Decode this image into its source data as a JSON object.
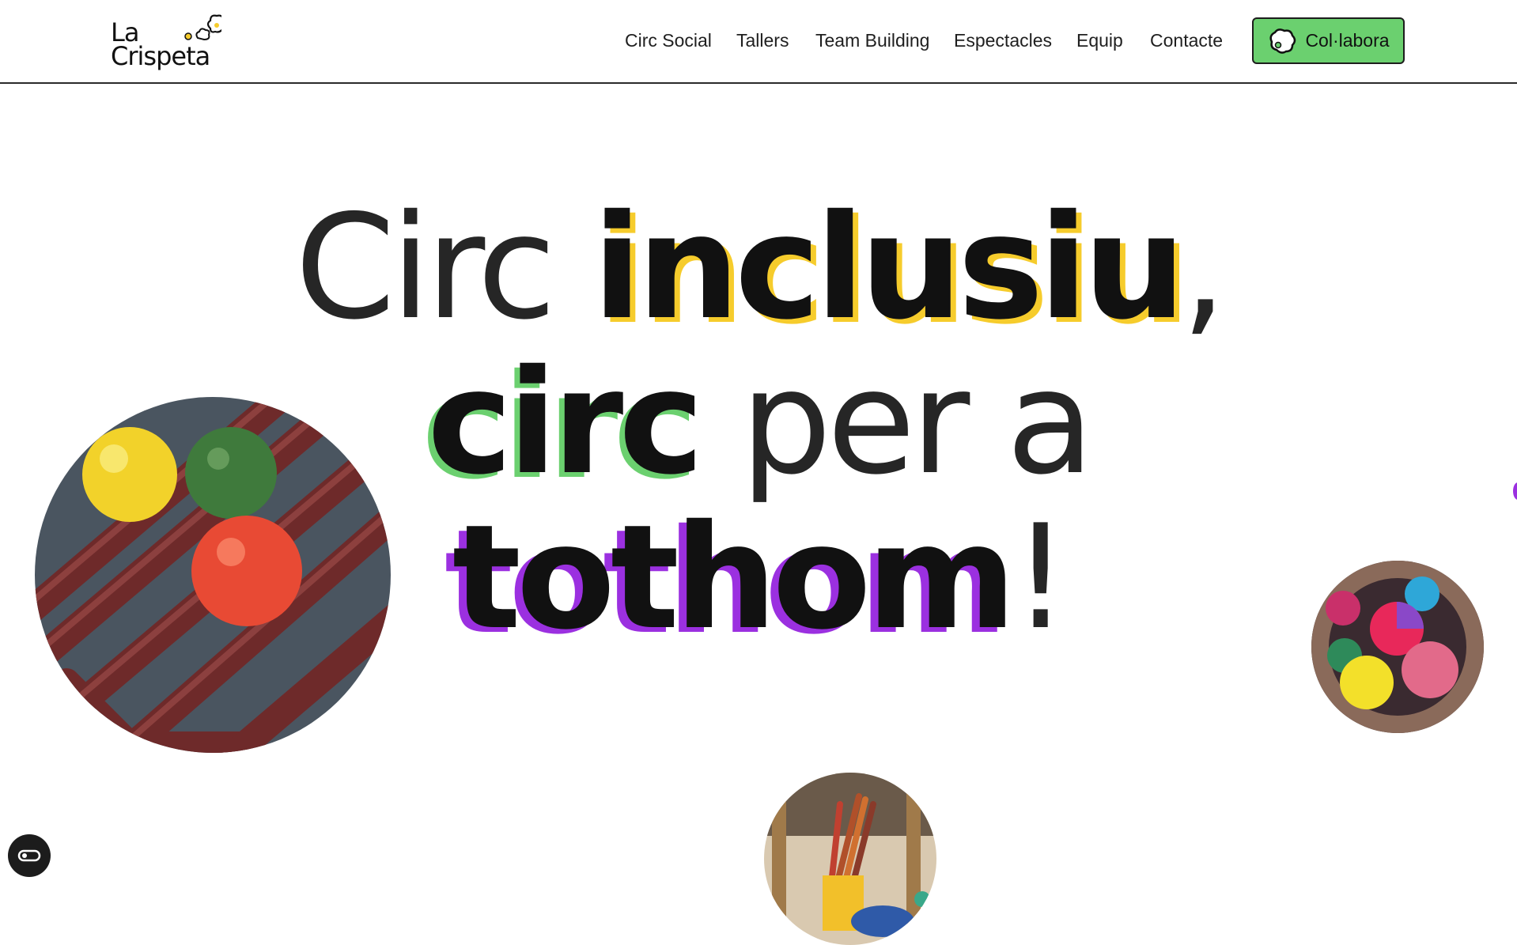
{
  "header": {
    "logo": {
      "line1": "La",
      "line2": "Crispeta",
      "icon": "popcorn-icon"
    },
    "nav": [
      {
        "label": "Circ Social"
      },
      {
        "label": "Tallers"
      },
      {
        "label": "Team Building"
      },
      {
        "label": "Espectacles"
      },
      {
        "label": "Equip"
      },
      {
        "label": "Contacte"
      }
    ],
    "cta": {
      "label": "Col·labora",
      "icon": "popcorn-icon"
    }
  },
  "hero": {
    "line1": {
      "plain": "Circ ",
      "bold": "inclusiu",
      "tail": ","
    },
    "line2": {
      "bold": "circ",
      "plain": " per a"
    },
    "line3": {
      "bold": "tothom",
      "tail": "!"
    }
  },
  "images": [
    {
      "name": "juggling-balls-on-pipes",
      "description_icon": "photo-icon"
    },
    {
      "name": "colorful-juggling-balls-basket",
      "description_icon": "photo-icon"
    },
    {
      "name": "circus-equipment-sticks",
      "description_icon": "photo-icon"
    }
  ],
  "colors": {
    "accent_green": "#6bd06f",
    "accent_yellow": "#f6cc2c",
    "accent_purple": "#9b30e0",
    "text": "#1f1f1f"
  },
  "cookie_button": {
    "icon": "cookie-settings-icon"
  }
}
